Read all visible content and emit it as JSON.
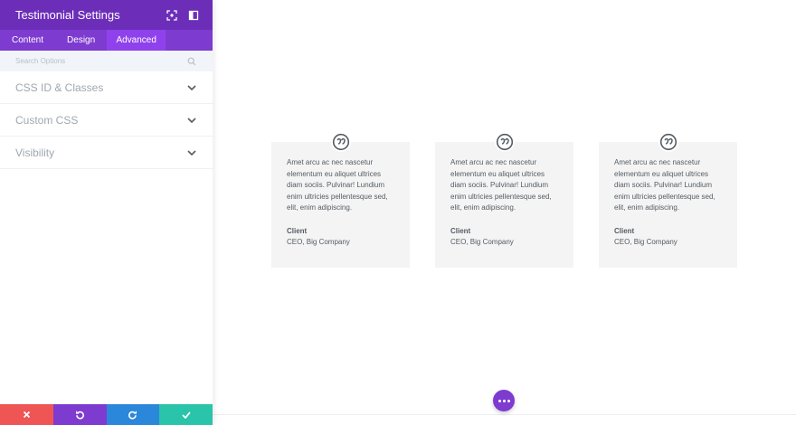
{
  "panel": {
    "title": "Testimonial Settings",
    "tabs": [
      {
        "label": "Content",
        "active": false
      },
      {
        "label": "Design",
        "active": false
      },
      {
        "label": "Advanced",
        "active": true
      }
    ],
    "search": {
      "placeholder": "Search Options",
      "value": ""
    },
    "sections": [
      {
        "label": "CSS ID & Classes"
      },
      {
        "label": "Custom CSS"
      },
      {
        "label": "Visibility"
      }
    ],
    "footer": {
      "buttons": [
        {
          "name": "discard",
          "icon": "close-icon",
          "color": "#ef5555"
        },
        {
          "name": "undo",
          "icon": "undo-icon",
          "color": "#7e3bd0"
        },
        {
          "name": "redo",
          "icon": "redo-icon",
          "color": "#2b87da"
        },
        {
          "name": "save",
          "icon": "check-icon",
          "color": "#29c4a9"
        }
      ]
    },
    "colors": {
      "header": "#6c2eb9",
      "tabs": "#7e3bd0",
      "active_tab": "#8f42ec"
    }
  },
  "testimonials": [
    {
      "body": "Amet arcu ac nec nascetur elementum eu aliquet ultrices diam sociis. Pulvinar! Lundium enim ultricies pellentesque sed, elit, enim adipiscing.",
      "name": "Client",
      "role": "CEO, Big Company"
    },
    {
      "body": "Amet arcu ac nec nascetur elementum eu aliquet ultrices diam sociis. Pulvinar! Lundium enim ultricies pellentesque sed, elit, enim adipiscing.",
      "name": "Client",
      "role": "CEO, Big Company"
    },
    {
      "body": "Amet arcu ac nec nascetur elementum eu aliquet ultrices diam sociis. Pulvinar! Lundium enim ultricies pellentesque sed, elit, enim adipiscing.",
      "name": "Client",
      "role": "CEO, Big Company"
    }
  ]
}
